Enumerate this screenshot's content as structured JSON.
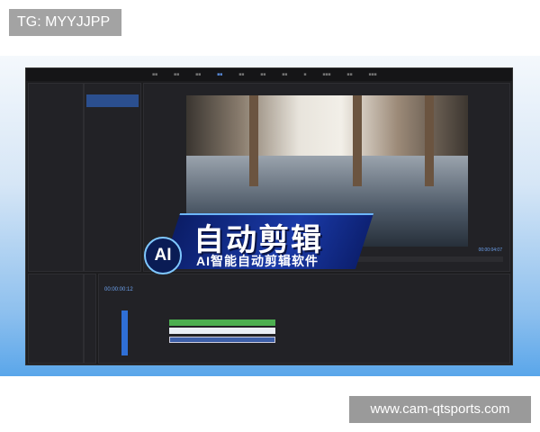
{
  "watermark_top": "TG: MYYJJPP",
  "watermark_bottom": "www.cam-qtsports.com",
  "overlay": {
    "badge": "AI",
    "title": "自动剪辑",
    "subtitle": "AI智能自动剪辑软件"
  },
  "editor": {
    "program_timecode": "00:00:04:07",
    "timeline_timecode": "00:00:00:12"
  },
  "colors": {
    "accent": "#5a8ee0",
    "clip_green": "#4caf50",
    "clip_blue": "#3d5fa8"
  }
}
